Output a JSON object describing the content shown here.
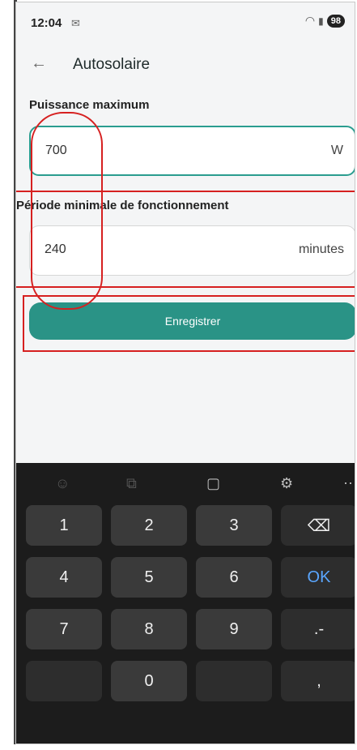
{
  "status": {
    "time": "12:04",
    "battery": "98"
  },
  "header": {
    "title": "Autosolaire"
  },
  "fields": [
    {
      "label": "Puissance maximum",
      "value": "700",
      "unit": "W"
    },
    {
      "label": "Période minimale de fonctionnement",
      "value": "240",
      "unit": "minutes"
    }
  ],
  "save_label": "Enregistrer",
  "keyboard": {
    "toolbar": [
      "emoji-icon",
      "sticker-icon",
      "clipboard-icon",
      "settings-icon",
      "more-icon"
    ],
    "keys": [
      "1",
      "2",
      "3",
      "⌫",
      "4",
      "5",
      "6",
      "OK",
      "7",
      "8",
      "9",
      ".-",
      "",
      "0",
      ","
    ]
  },
  "colors": {
    "accent": "#2a9386",
    "annotation": "#d62020"
  }
}
